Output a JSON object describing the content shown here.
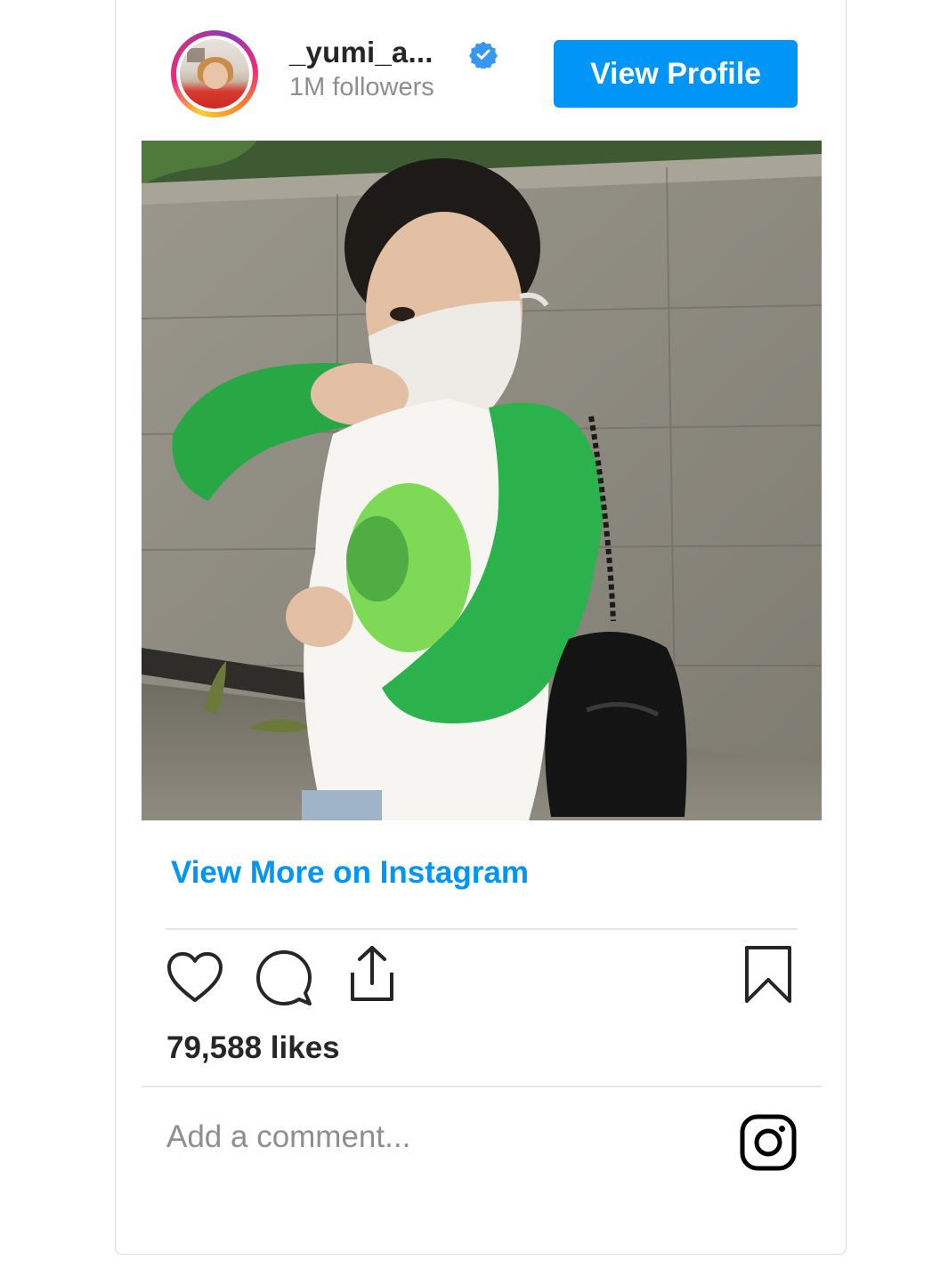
{
  "header": {
    "username": "_yumi_a...",
    "followers": "1M followers",
    "view_profile_label": "View Profile",
    "avatar_icon": "profile-avatar",
    "verified_icon": "verified-badge-icon"
  },
  "post": {
    "image_alt": "photo"
  },
  "links": {
    "view_more": "View More on Instagram"
  },
  "actions": {
    "like_icon": "heart-icon",
    "comment_icon": "comment-icon",
    "share_icon": "share-icon",
    "save_icon": "bookmark-icon"
  },
  "stats": {
    "likes": "79,588 likes"
  },
  "comment": {
    "placeholder": "Add a comment..."
  },
  "colors": {
    "accent": "#0095f6",
    "text": "#262626",
    "muted": "#8e8e8e"
  }
}
